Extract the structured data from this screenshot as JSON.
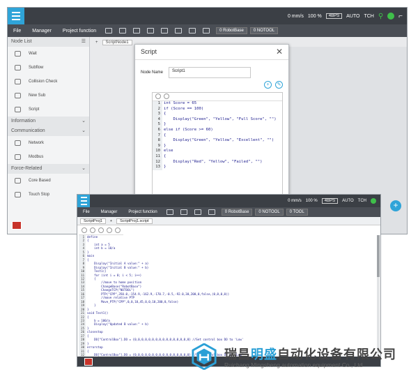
{
  "app": {
    "status_speed": "0 mm/s",
    "status_percent": "100 %",
    "status_fps": "4BPS",
    "status_mode": "AUTO",
    "status_tch": "TCH",
    "menu": [
      "File",
      "Manager",
      "Project function"
    ],
    "dropdown_base": "0 RobotBase",
    "dropdown_tool": "0 NOTOOL",
    "dropdown_extra": "0 TOOL"
  },
  "left_panel": {
    "node_list_title": "Node List",
    "items_top": [
      "Wait",
      "Subflow",
      "Collision Check",
      "New Sub",
      "Script"
    ],
    "information": "Information",
    "communication": "Communication",
    "comm_items": [
      "Network",
      "Modbus"
    ],
    "force_section": "Force-Related",
    "force_items": [
      "Core Based",
      "Touch Stop"
    ]
  },
  "tab": {
    "script_node": "ScriptNode1",
    "script_project": "ScriptProj1",
    "script_text": "ScriptProj1.script"
  },
  "dialog": {
    "title": "Script",
    "node_name_label": "Node Name",
    "node_name_value": "Script1",
    "lines": [
      "int Score = 65",
      "if (Score == 100)",
      "{",
      "    Display(\"Green\", \"Yellow\", \"Full Score\", \"\")",
      "}",
      "else if (Score >= 60)",
      "{",
      "    Display(\"Green\", \"Yellow\", \"Excellent\", \"\")",
      "}",
      "else",
      "{",
      "    Display(\"Red\", \"Yellow\", \"Failed\", \"\")",
      "}"
    ]
  },
  "second": {
    "lines": [
      "define",
      "{",
      "    int a = 5",
      "    int b = 10/a",
      "}",
      "main",
      "{",
      "    Display(\"Initial A value:\" + a)",
      "    Display(\"Initial B value:\" + b)",
      "    Test1()",
      "    for (int i = 0; i < 5; i++)",
      "    {",
      "        //move to home position",
      "        ChangeBase(\"RobotBase\")",
      "        ChangeTCP(\"NOTOOL\")",
      "        PTP(\"CPP\",350.0,-154.9,-162.9,-170.7,-0.5,-92.0,30,200,0,false,(0,0,0,0))",
      "        //move relative PTP",
      "        Move_PTP(\"CPP\",0,0,10,45,0,0,10,200,0,false)",
      "    }",
      "}",
      "void Test1()",
      "{",
      "    b = 100/a",
      "    Display(\"Updated B value:\" + b)",
      "}",
      "closestop",
      "{",
      "    DO[\"ControlBox\"].DO = {0,0,0,0,0,0,0,0,0,0,0,0,0,0,0,0} //Set control box DO to 'Low'",
      "}",
      "errorstop",
      "{",
      "    DO[\"ControlBox\"].DO = {0,0,0,0,0,0,0,0,0,0,0,0,0,0,0,0} //Set control box DO to 'Low'"
    ]
  },
  "brand": {
    "cn_a": "瑞昌",
    "cn_b": "明盛",
    "cn_c": "自动化设备有限公司",
    "en": "Ruichang Mingsheng automation equipment Co., Ltd"
  },
  "colors": {
    "accent": "#2fa4d8",
    "bar": "#3b3f45",
    "estop": "#c7332a",
    "ok": "#3fbf4a"
  }
}
